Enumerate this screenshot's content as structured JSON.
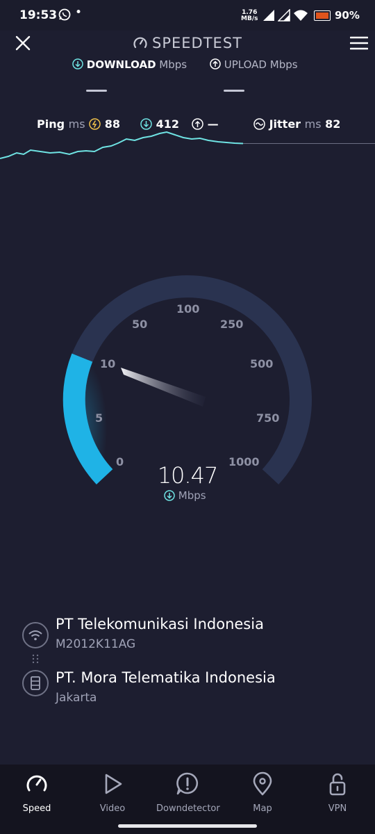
{
  "status_bar": {
    "time": "19:53",
    "net_speed_value": "1.76",
    "net_speed_unit": "MB/s",
    "battery": "90%"
  },
  "header": {
    "title": "SPEEDTEST",
    "download_label": "DOWNLOAD",
    "download_unit": "Mbps",
    "upload_label": "UPLOAD",
    "upload_unit": "Mbps"
  },
  "metrics": {
    "ping_label": "Ping",
    "ping_unit": "ms",
    "ping_idle": "88",
    "ping_download": "412",
    "ping_upload": "—",
    "jitter_label": "Jitter",
    "jitter_unit": "ms",
    "jitter_value": "82"
  },
  "gauge": {
    "ticks": [
      "0",
      "5",
      "10",
      "50",
      "100",
      "250",
      "500",
      "750",
      "1000"
    ],
    "reading": "10.47",
    "unit": "Mbps",
    "active_color": "#1fb3e6",
    "track_color": "#2a3350"
  },
  "servers": {
    "provider_name": "PT Telekomunikasi Indonesia",
    "device_name": "M2012K11AG",
    "host_name": "PT. Mora Telematika Indonesia",
    "host_location": "Jakarta"
  },
  "nav": {
    "items": [
      {
        "label": "Speed",
        "icon": "gauge-icon"
      },
      {
        "label": "Video",
        "icon": "play-icon"
      },
      {
        "label": "Downdetector",
        "icon": "alert-icon"
      },
      {
        "label": "Map",
        "icon": "map-pin-icon"
      },
      {
        "label": "VPN",
        "icon": "unlock-icon"
      }
    ]
  },
  "colors": {
    "background": "#1d1e30",
    "accent": "#6fe3e3"
  }
}
